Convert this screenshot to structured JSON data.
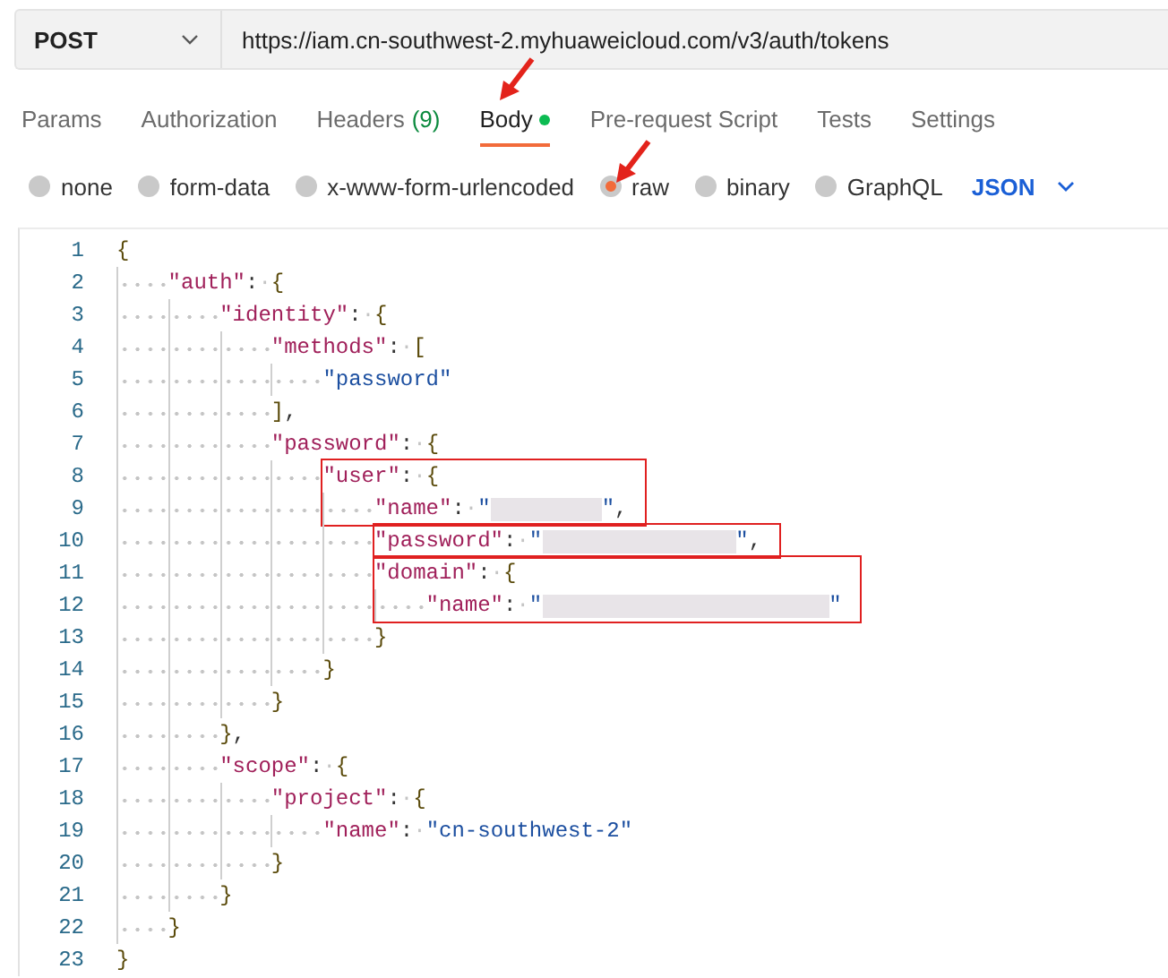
{
  "request": {
    "method": "POST",
    "url": "https://iam.cn-southwest-2.myhuaweicloud.com/v3/auth/tokens"
  },
  "tabs": [
    {
      "label": "Params",
      "selected": false
    },
    {
      "label": "Authorization",
      "selected": false
    },
    {
      "label": "Headers",
      "count": "(9)",
      "selected": false
    },
    {
      "label": "Body",
      "indicator": true,
      "annotated": true,
      "selected": true
    },
    {
      "label": "Pre-request Script",
      "selected": false
    },
    {
      "label": "Tests",
      "selected": false
    },
    {
      "label": "Settings",
      "selected": false
    }
  ],
  "body_types": [
    {
      "label": "none",
      "selected": false
    },
    {
      "label": "form-data",
      "selected": false
    },
    {
      "label": "x-www-form-urlencoded",
      "selected": false
    },
    {
      "label": "raw",
      "selected": true,
      "annotated": true
    },
    {
      "label": "binary",
      "selected": false
    },
    {
      "label": "GraphQL",
      "selected": false
    }
  ],
  "format": "JSON",
  "editor": {
    "blocks": [
      {
        "highlighted": false,
        "lines": [
          {
            "number": "1",
            "tokens": [
              {
                "kind": "brace",
                "text": "{"
              }
            ]
          },
          {
            "number": "2",
            "tokens": [
              {
                "kind": "key",
                "text": "\"auth\""
              },
              {
                "kind": "punct",
                "text": ":"
              },
              {
                "kind": "space",
                "text": "·"
              },
              {
                "kind": "brace",
                "text": "{"
              }
            ]
          },
          {
            "number": "3",
            "tokens": [
              {
                "kind": "key",
                "text": "\"identity\""
              },
              {
                "kind": "punct",
                "text": ":"
              },
              {
                "kind": "space",
                "text": "·"
              },
              {
                "kind": "brace",
                "text": "{"
              }
            ]
          },
          {
            "number": "4",
            "tokens": [
              {
                "kind": "key",
                "text": "\"methods\""
              },
              {
                "kind": "punct",
                "text": ":"
              },
              {
                "kind": "space",
                "text": "·"
              },
              {
                "kind": "brace",
                "text": "["
              }
            ]
          },
          {
            "number": "5",
            "tokens": [
              {
                "kind": "string",
                "text": "\"password\""
              }
            ]
          },
          {
            "number": "6",
            "tokens": [
              {
                "kind": "brace",
                "text": "]"
              },
              {
                "kind": "punct",
                "text": ","
              }
            ]
          },
          {
            "number": "7",
            "tokens": [
              {
                "kind": "key",
                "text": "\"password\""
              },
              {
                "kind": "punct",
                "text": ":"
              },
              {
                "kind": "space",
                "text": "·"
              },
              {
                "kind": "brace",
                "text": "{"
              }
            ]
          }
        ]
      },
      {
        "highlighted": true,
        "lines": [
          {
            "number": "8",
            "tokens": [
              {
                "kind": "key",
                "text": "\"user\""
              },
              {
                "kind": "punct",
                "text": ":"
              },
              {
                "kind": "space",
                "text": "·"
              },
              {
                "kind": "brace",
                "text": "{"
              }
            ]
          },
          {
            "number": "9",
            "tokens": [
              {
                "kind": "key",
                "text": "\"name\""
              },
              {
                "kind": "punct",
                "text": ":"
              },
              {
                "kind": "space",
                "text": "·"
              },
              {
                "kind": "string",
                "text": "\""
              },
              {
                "kind": "redacted-short"
              },
              {
                "kind": "string",
                "text": "\""
              },
              {
                "kind": "punct",
                "text": ","
              }
            ]
          }
        ]
      },
      {
        "highlighted": true,
        "lines": [
          {
            "number": "10",
            "tokens": [
              {
                "kind": "key",
                "text": "\"password\""
              },
              {
                "kind": "punct",
                "text": ":"
              },
              {
                "kind": "space",
                "text": "·"
              },
              {
                "kind": "string",
                "text": "\""
              },
              {
                "kind": "redacted-medium"
              },
              {
                "kind": "string",
                "text": "\""
              },
              {
                "kind": "punct",
                "text": ","
              }
            ]
          }
        ]
      },
      {
        "highlighted": true,
        "lines": [
          {
            "number": "11",
            "tokens": [
              {
                "kind": "key",
                "text": "\"domain\""
              },
              {
                "kind": "punct",
                "text": ":"
              },
              {
                "kind": "space",
                "text": "·"
              },
              {
                "kind": "brace",
                "text": "{"
              }
            ]
          },
          {
            "number": "12",
            "tokens": [
              {
                "kind": "key",
                "text": "\"name\""
              },
              {
                "kind": "punct",
                "text": ":"
              },
              {
                "kind": "space",
                "text": "·"
              },
              {
                "kind": "string",
                "text": "\""
              },
              {
                "kind": "redacted-long"
              },
              {
                "kind": "string",
                "text": "\""
              }
            ]
          }
        ]
      },
      {
        "highlighted": false,
        "lines": [
          {
            "number": "13",
            "tokens": [
              {
                "kind": "brace",
                "text": "}"
              }
            ]
          },
          {
            "number": "14",
            "tokens": [
              {
                "kind": "brace",
                "text": "}"
              }
            ]
          },
          {
            "number": "15",
            "tokens": [
              {
                "kind": "brace",
                "text": "}"
              }
            ]
          },
          {
            "number": "16",
            "tokens": [
              {
                "kind": "brace",
                "text": "}"
              },
              {
                "kind": "punct",
                "text": ","
              }
            ]
          },
          {
            "number": "17",
            "tokens": [
              {
                "kind": "key",
                "text": "\"scope\""
              },
              {
                "kind": "punct",
                "text": ":"
              },
              {
                "kind": "space",
                "text": "·"
              },
              {
                "kind": "brace",
                "text": "{"
              }
            ]
          },
          {
            "number": "18",
            "tokens": [
              {
                "kind": "key",
                "text": "\"project\""
              },
              {
                "kind": "punct",
                "text": ":"
              },
              {
                "kind": "space",
                "text": "·"
              },
              {
                "kind": "brace",
                "text": "{"
              }
            ]
          },
          {
            "number": "19",
            "tokens": [
              {
                "kind": "key",
                "text": "\"name\""
              },
              {
                "kind": "punct",
                "text": ":"
              },
              {
                "kind": "space",
                "text": "·"
              },
              {
                "kind": "string",
                "text": "\"cn-southwest-2\""
              }
            ]
          },
          {
            "number": "20",
            "tokens": [
              {
                "kind": "brace",
                "text": "}"
              }
            ]
          },
          {
            "number": "21",
            "tokens": [
              {
                "kind": "brace",
                "text": "}"
              }
            ]
          },
          {
            "number": "22",
            "tokens": [
              {
                "kind": "brace",
                "text": "}"
              }
            ]
          },
          {
            "number": "23",
            "tokens": [
              {
                "kind": "brace",
                "text": "}"
              }
            ]
          }
        ]
      }
    ]
  }
}
